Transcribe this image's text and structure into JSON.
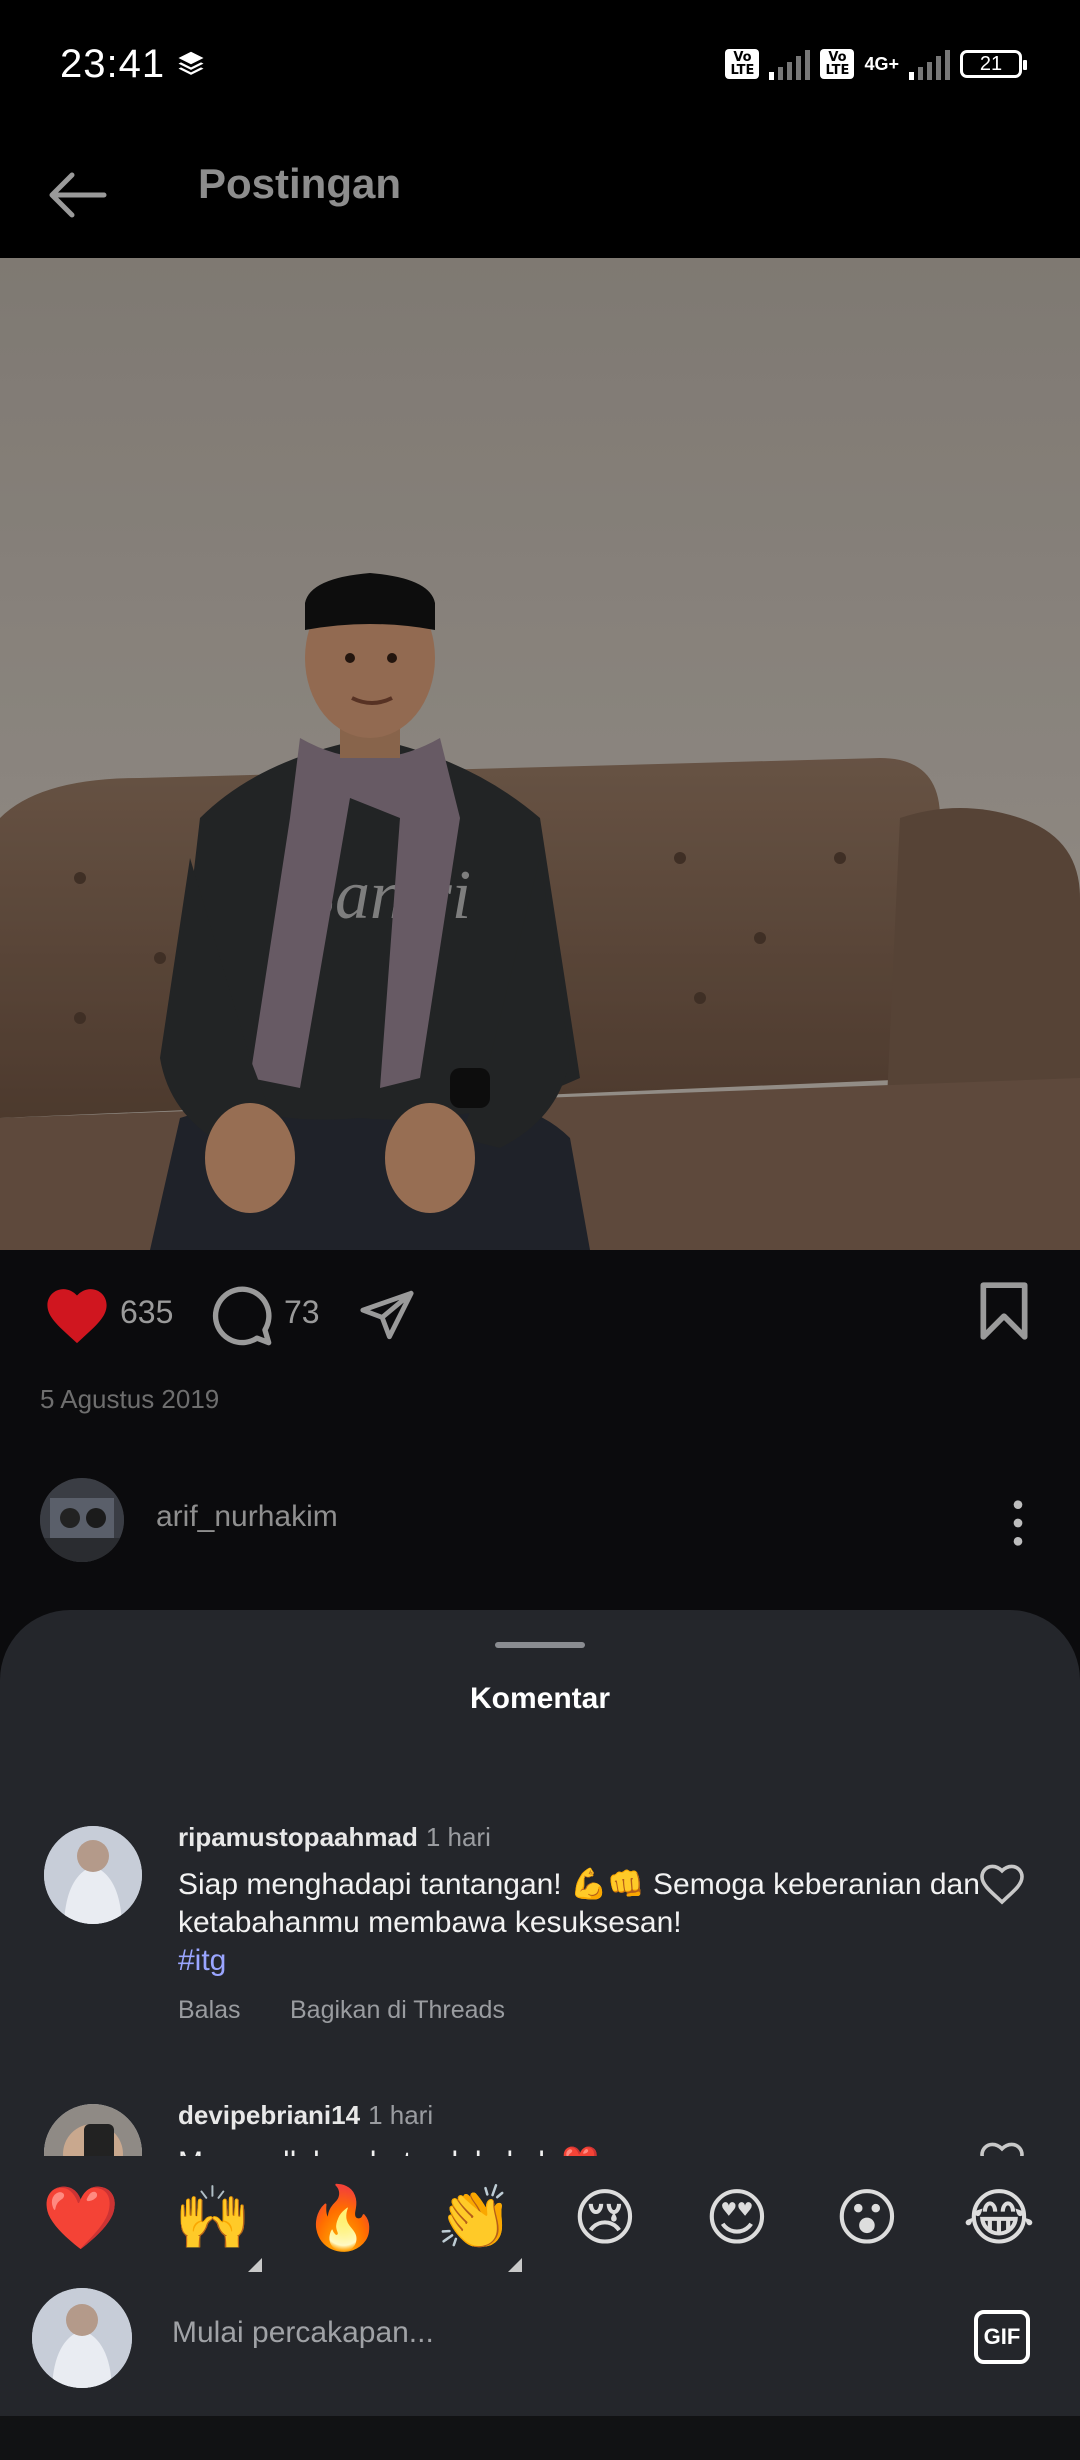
{
  "status_bar": {
    "time": "23:41",
    "network_label": "4G+",
    "volte": "Vo LTE",
    "battery": "21"
  },
  "header": {
    "title": "Postingan"
  },
  "post": {
    "likes": "635",
    "comments": "73",
    "date": "5 Agustus 2019",
    "author": "arif_nurhakim"
  },
  "comments_sheet": {
    "title": "Komentar",
    "comments": [
      {
        "user": "ripamustopaahmad",
        "time": "1 hari",
        "text": "Siap menghadapi tantangan! 💪👊 Semoga keberanian dan ketabahanmu membawa kesuksesan!",
        "hashtag": "#itg",
        "reply": "Balas",
        "share": "Bagikan di Threads"
      },
      {
        "user": "devipebriani14",
        "time": "1 hari",
        "text": "Masyaallah sehat selalu kak ❤️"
      }
    ]
  },
  "emoji_bar": [
    "❤️",
    "🙌",
    "🔥",
    "👏",
    "😢",
    "😍",
    "😮",
    "😂"
  ],
  "composer": {
    "placeholder": "Mulai percakapan...",
    "gif_label": "GIF"
  },
  "colors": {
    "like_red": "#d0161f",
    "sheet_bg": "#24262b",
    "hashtag": "#9aa5ff"
  }
}
